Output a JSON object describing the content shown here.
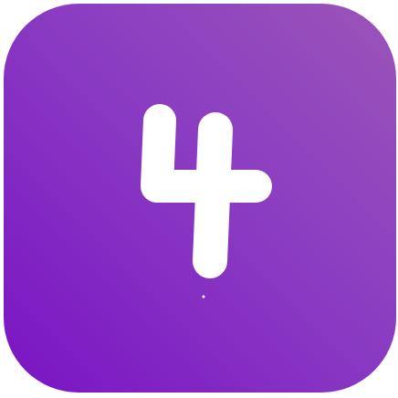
{
  "badge": {
    "label": "4",
    "colors": {
      "gradient_light": "#9b54b8",
      "gradient_mid": "#8a3cc2",
      "gradient_dark": "#7a13c4",
      "glyph": "#ffffff"
    }
  }
}
